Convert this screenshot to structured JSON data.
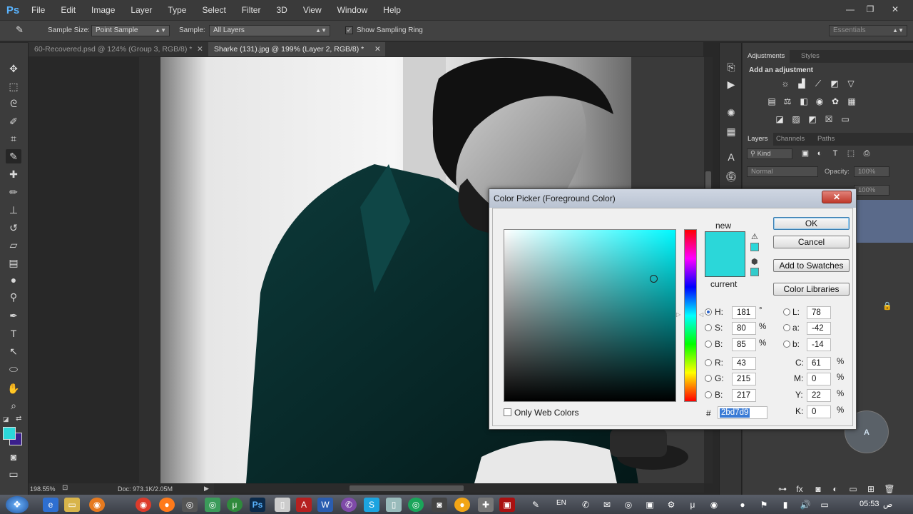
{
  "app": {
    "logo": "Ps",
    "menus": [
      "File",
      "Edit",
      "Image",
      "Layer",
      "Type",
      "Select",
      "Filter",
      "3D",
      "View",
      "Window",
      "Help"
    ],
    "window_controls": [
      "—",
      "❐",
      "✕"
    ]
  },
  "options_bar": {
    "sample_size_label": "Sample Size:",
    "sample_size_value": "Point Sample",
    "sample_label": "Sample:",
    "sample_value": "All Layers",
    "show_sampling_ring_label": "Show Sampling Ring",
    "show_sampling_ring_checked": true,
    "workspace": "Essentials"
  },
  "doc_tabs": [
    {
      "label": "60-Recovered.psd @ 124% (Group 3, RGB/8) *",
      "active": false
    },
    {
      "label": "Sharke    (131).jpg @ 199% (Layer 2, RGB/8) *",
      "active": true
    }
  ],
  "status_bar": {
    "zoom": "198.55%",
    "doc": "Doc: 973.1K/2.05M"
  },
  "right_panel": {
    "adjustments_tabs": [
      "Adjustments",
      "Styles"
    ],
    "add_adjustment": "Add an adjustment",
    "layers_tabs": [
      "Layers",
      "Channels",
      "Paths"
    ],
    "kind_label": "Kind",
    "blend_mode": "Normal",
    "opacity_label": "Opacity:",
    "opacity_value": "100%",
    "fill_value": "100%"
  },
  "color_picker": {
    "title": "Color Picker (Foreground Color)",
    "close": "✕",
    "new_label": "new",
    "current_label": "current",
    "new_color": "#2bd7d9",
    "current_color": "#2bd7d9",
    "buttons": {
      "ok": "OK",
      "cancel": "Cancel",
      "add_to_swatches": "Add to Swatches",
      "color_libraries": "Color Libraries"
    },
    "hsb": {
      "h_label": "H:",
      "h": "181",
      "h_unit": "°",
      "s_label": "S:",
      "s": "80",
      "s_unit": "%",
      "b_label": "B:",
      "b": "85",
      "b_unit": "%"
    },
    "rgb": {
      "r_label": "R:",
      "r": "43",
      "g_label": "G:",
      "g": "215",
      "b_label": "B:",
      "b": "217"
    },
    "lab": {
      "l_label": "L:",
      "l": "78",
      "a_label": "a:",
      "a": "-42",
      "b_label": "b:",
      "b": "-14"
    },
    "cmyk": {
      "c_label": "C:",
      "c": "61",
      "m_label": "M:",
      "m": "0",
      "y_label": "Y:",
      "y": "22",
      "k_label": "K:",
      "k": "0",
      "unit": "%"
    },
    "hex_label": "#",
    "hex": "2bd7d9",
    "only_web_colors": "Only Web Colors"
  },
  "swatches": {
    "foreground": "#2bd7d9",
    "background": "#3a1f8c"
  },
  "taskbar": {
    "language": "EN",
    "time": "05:53",
    "ampm": "ص"
  }
}
